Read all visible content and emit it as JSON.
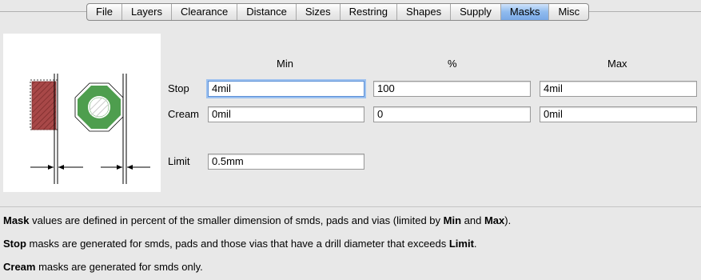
{
  "tabs": [
    {
      "label": "File",
      "active": false
    },
    {
      "label": "Layers",
      "active": false
    },
    {
      "label": "Clearance",
      "active": false
    },
    {
      "label": "Distance",
      "active": false
    },
    {
      "label": "Sizes",
      "active": false
    },
    {
      "label": "Restring",
      "active": false
    },
    {
      "label": "Shapes",
      "active": false
    },
    {
      "label": "Supply",
      "active": false
    },
    {
      "label": "Masks",
      "active": true
    },
    {
      "label": "Misc",
      "active": false
    }
  ],
  "columns": {
    "min": "Min",
    "percent": "%",
    "max": "Max"
  },
  "rows": {
    "stop": {
      "label": "Stop",
      "min": "4mil",
      "percent": "100",
      "max": "4mil"
    },
    "cream": {
      "label": "Cream",
      "min": "0mil",
      "percent": "0",
      "max": "0mil"
    },
    "limit": {
      "label": "Limit",
      "value": "0.5mm"
    }
  },
  "description": {
    "line1": {
      "bold": "Mask",
      "text1": " values are defined in percent of the smaller dimension of smds, pads and vias (limited by ",
      "bold2": "Min",
      "text2": " and ",
      "bold3": "Max",
      "text3": ")."
    },
    "line2": {
      "bold": "Stop",
      "text1": " masks are generated for smds, pads and those vias that have a drill diameter that exceeds ",
      "bold2": "Limit",
      "text2": "."
    },
    "line3": {
      "bold": "Cream",
      "text1": " masks are generated for smds only."
    }
  },
  "colors": {
    "smd": "#9e3a3a",
    "pad": "#4e9e4e",
    "active_tab": "#8fbbee"
  }
}
